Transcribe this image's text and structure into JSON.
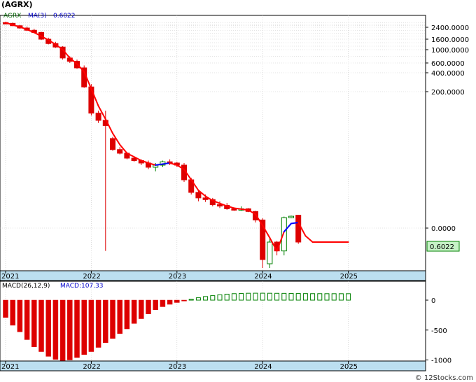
{
  "title": "(AGRX)",
  "footer": "© 12Stocks.com",
  "colors": {
    "up": "#008000",
    "down": "#dd0000",
    "ma_down": "#ff0000",
    "ma_up": "#0000ff",
    "axis_band": "#bcdff0",
    "value_box_bg": "#c6f2c6",
    "value_box_border": "#008000"
  },
  "price_panel": {
    "legend": {
      "ticker": "AGRX",
      "ma_label": "MA(3)",
      "ma_value": "0.6022"
    },
    "last_value": "0.6022",
    "y_tick_labels": [
      {
        "label": "2400.0000",
        "value": 2400
      },
      {
        "label": "1600.0000",
        "value": 1600
      },
      {
        "label": "1000.0000",
        "value": 1000
      },
      {
        "label": "600.0000",
        "value": 600
      },
      {
        "label": "400.0000",
        "value": 400
      },
      {
        "label": "200.0000",
        "value": 200
      },
      {
        "label": "0.0000",
        "value": 0
      }
    ]
  },
  "macd_panel": {
    "legend": {
      "params": "MACD(26,12,9)",
      "value_label": "MACD:107.33"
    },
    "y_tick_labels": [
      {
        "label": "0",
        "value": 0
      },
      {
        "label": "-500",
        "value": -500
      },
      {
        "label": "-1000",
        "value": -1000
      }
    ]
  },
  "x_axis_labels": [
    "2021",
    "2022",
    "2023",
    "2024",
    "2025"
  ],
  "chart_data": {
    "type": "candlestick",
    "title": "(AGRX)",
    "x_axis": {
      "labels": [
        "2021",
        "2022",
        "2023",
        "2024",
        "2025"
      ],
      "months": [
        0,
        12,
        24,
        36,
        48
      ]
    },
    "price_scale": "non-linear (compressed at top)",
    "candles": [
      {
        "m": 0,
        "open": 3000,
        "high": 3100,
        "low": 2800,
        "close": 2900,
        "dir": "down"
      },
      {
        "m": 1,
        "open": 2900,
        "high": 3000,
        "low": 2550,
        "close": 2600,
        "dir": "down"
      },
      {
        "m": 2,
        "open": 2600,
        "high": 2700,
        "low": 2300,
        "close": 2350,
        "dir": "down"
      },
      {
        "m": 3,
        "open": 2350,
        "high": 2500,
        "low": 2150,
        "close": 2200,
        "dir": "down"
      },
      {
        "m": 4,
        "open": 2200,
        "high": 2300,
        "low": 2000,
        "close": 2050,
        "dir": "down"
      },
      {
        "m": 5,
        "open": 2050,
        "high": 2100,
        "low": 1550,
        "close": 1600,
        "dir": "down"
      },
      {
        "m": 6,
        "open": 1600,
        "high": 1700,
        "low": 1300,
        "close": 1350,
        "dir": "down"
      },
      {
        "m": 7,
        "open": 1350,
        "high": 1450,
        "low": 1100,
        "close": 1150,
        "dir": "down"
      },
      {
        "m": 8,
        "open": 1150,
        "high": 1200,
        "low": 700,
        "close": 750,
        "dir": "down"
      },
      {
        "m": 9,
        "open": 750,
        "high": 800,
        "low": 600,
        "close": 650,
        "dir": "down"
      },
      {
        "m": 10,
        "open": 650,
        "high": 700,
        "low": 480,
        "close": 500,
        "dir": "down"
      },
      {
        "m": 11,
        "open": 500,
        "high": 550,
        "low": 240,
        "close": 250,
        "dir": "down"
      },
      {
        "m": 12,
        "open": 250,
        "high": 280,
        "low": 100,
        "close": 110,
        "dir": "down"
      },
      {
        "m": 13,
        "open": 110,
        "high": 120,
        "low": 75,
        "close": 80,
        "dir": "down"
      },
      {
        "m": 14,
        "open": 80,
        "high": 120,
        "low": 0.5,
        "close": 70,
        "dir": "down"
      },
      {
        "m": 15,
        "open": 45,
        "high": 48,
        "low": 35,
        "close": 36,
        "dir": "down"
      },
      {
        "m": 16,
        "open": 36,
        "high": 38,
        "low": 32,
        "close": 33,
        "dir": "down"
      },
      {
        "m": 17,
        "open": 33,
        "high": 34,
        "low": 28,
        "close": 29,
        "dir": "down"
      },
      {
        "m": 18,
        "open": 29,
        "high": 30,
        "low": 26,
        "close": 27,
        "dir": "down"
      },
      {
        "m": 19,
        "open": 27,
        "high": 28,
        "low": 24,
        "close": 25,
        "dir": "down"
      },
      {
        "m": 20,
        "open": 25,
        "high": 27,
        "low": 22,
        "close": 23,
        "dir": "down"
      },
      {
        "m": 21,
        "open": 23,
        "high": 25,
        "low": 21,
        "close": 24,
        "dir": "up"
      },
      {
        "m": 22,
        "open": 24,
        "high": 27,
        "low": 23,
        "close": 26,
        "dir": "up"
      },
      {
        "m": 23,
        "open": 26,
        "high": 28,
        "low": 24,
        "close": 25,
        "dir": "down"
      },
      {
        "m": 24,
        "open": 25,
        "high": 26,
        "low": 23,
        "close": 24,
        "dir": "down"
      },
      {
        "m": 25,
        "open": 24,
        "high": 25,
        "low": 16,
        "close": 17,
        "dir": "down"
      },
      {
        "m": 26,
        "open": 17,
        "high": 18,
        "low": 10,
        "close": 11,
        "dir": "down"
      },
      {
        "m": 27,
        "open": 11,
        "high": 12,
        "low": 8,
        "close": 9,
        "dir": "down"
      },
      {
        "m": 28,
        "open": 9,
        "high": 10,
        "low": 7.8,
        "close": 8.5,
        "dir": "down"
      },
      {
        "m": 29,
        "open": 8.5,
        "high": 9,
        "low": 6.5,
        "close": 7,
        "dir": "down"
      },
      {
        "m": 30,
        "open": 7,
        "high": 8,
        "low": 6,
        "close": 6.8,
        "dir": "down"
      },
      {
        "m": 31,
        "open": 6.8,
        "high": 7.5,
        "low": 5.5,
        "close": 5.8,
        "dir": "down"
      },
      {
        "m": 32,
        "open": 5.8,
        "high": 6.2,
        "low": 5.2,
        "close": 5.6,
        "dir": "down"
      },
      {
        "m": 33,
        "open": 5.6,
        "high": 6.5,
        "low": 5.2,
        "close": 5.8,
        "dir": "up"
      },
      {
        "m": 34,
        "open": 5.8,
        "high": 6.0,
        "low": 4.8,
        "close": 5.0,
        "dir": "down"
      },
      {
        "m": 35,
        "open": 5.0,
        "high": 5.2,
        "low": 2.5,
        "close": 2.8,
        "dir": "down"
      },
      {
        "m": 36,
        "open": 2.8,
        "high": 3.0,
        "low": 0.3,
        "close": 0.4,
        "dir": "down"
      },
      {
        "m": 37,
        "open": 0.35,
        "high": 0.9,
        "low": 0.3,
        "close": 0.6,
        "dir": "up"
      },
      {
        "m": 38,
        "open": 0.6,
        "high": 0.7,
        "low": 0.45,
        "close": 0.5,
        "dir": "down"
      },
      {
        "m": 39,
        "open": 0.5,
        "high": 3.5,
        "low": 0.45,
        "close": 3.2,
        "dir": "up"
      },
      {
        "m": 40,
        "open": 3.2,
        "high": 3.8,
        "low": 3.0,
        "close": 3.6,
        "dir": "up"
      },
      {
        "m": 41,
        "open": 3.9,
        "high": 4.0,
        "low": 0.58,
        "close": 0.6022,
        "dir": "down"
      }
    ],
    "ma3": {
      "label": "MA(3)",
      "values": [
        [
          0,
          3000
        ],
        [
          1,
          2700
        ],
        [
          2,
          2450
        ],
        [
          3,
          2250
        ],
        [
          4,
          2050
        ],
        [
          5,
          1800
        ],
        [
          6,
          1550
        ],
        [
          7,
          1300
        ],
        [
          8,
          1000
        ],
        [
          9,
          750
        ],
        [
          10,
          580
        ],
        [
          11,
          420
        ],
        [
          12,
          230
        ],
        [
          13,
          140
        ],
        [
          14,
          85
        ],
        [
          15,
          55
        ],
        [
          16,
          40
        ],
        [
          17,
          33
        ],
        [
          18,
          30
        ],
        [
          19,
          27
        ],
        [
          20,
          25
        ],
        [
          21,
          24
        ],
        [
          22,
          24.5
        ],
        [
          23,
          25
        ],
        [
          24,
          24
        ],
        [
          25,
          22
        ],
        [
          26,
          17
        ],
        [
          27,
          12
        ],
        [
          28,
          9.5
        ],
        [
          29,
          8.2
        ],
        [
          30,
          7.4
        ],
        [
          31,
          6.6
        ],
        [
          32,
          6.0
        ],
        [
          33,
          5.7
        ],
        [
          34,
          5.4
        ],
        [
          35,
          4.2
        ],
        [
          36,
          2.2
        ],
        [
          37,
          1.0
        ],
        [
          38,
          0.5
        ],
        [
          39,
          1.6
        ],
        [
          40,
          2.4
        ],
        [
          41,
          2.5
        ],
        [
          42,
          1.2
        ],
        [
          43,
          0.6022
        ],
        [
          44,
          0.6022
        ],
        [
          45,
          0.6022
        ],
        [
          46,
          0.6022
        ],
        [
          47,
          0.6022
        ],
        [
          48,
          0.6022
        ]
      ],
      "up_segment_months": [
        21,
        22,
        23,
        39,
        40,
        41
      ]
    },
    "macd": {
      "label": "MACD(26,12,9)",
      "last_value": 107.33,
      "ylim": [
        -1050,
        120
      ],
      "values": [
        [
          0,
          -290
        ],
        [
          1,
          -420
        ],
        [
          2,
          -530
        ],
        [
          3,
          -660
        ],
        [
          4,
          -780
        ],
        [
          5,
          -860
        ],
        [
          6,
          -940
        ],
        [
          7,
          -990
        ],
        [
          8,
          -1010
        ],
        [
          9,
          -1000
        ],
        [
          10,
          -960
        ],
        [
          11,
          -910
        ],
        [
          12,
          -860
        ],
        [
          13,
          -790
        ],
        [
          14,
          -710
        ],
        [
          15,
          -640
        ],
        [
          16,
          -560
        ],
        [
          17,
          -480
        ],
        [
          18,
          -390
        ],
        [
          19,
          -310
        ],
        [
          20,
          -230
        ],
        [
          21,
          -160
        ],
        [
          22,
          -110
        ],
        [
          23,
          -70
        ],
        [
          24,
          -40
        ],
        [
          25,
          -15
        ],
        [
          26,
          15
        ],
        [
          27,
          40
        ],
        [
          28,
          60
        ],
        [
          29,
          75
        ],
        [
          30,
          90
        ],
        [
          31,
          100
        ],
        [
          32,
          108
        ],
        [
          33,
          112
        ],
        [
          34,
          115
        ],
        [
          35,
          116
        ],
        [
          36,
          116
        ],
        [
          37,
          115
        ],
        [
          38,
          114
        ],
        [
          39,
          113
        ],
        [
          40,
          112
        ],
        [
          41,
          110
        ],
        [
          42,
          109
        ],
        [
          43,
          108
        ],
        [
          44,
          108
        ],
        [
          45,
          107.5
        ],
        [
          46,
          107.4
        ],
        [
          47,
          107.33
        ],
        [
          48,
          107.33
        ]
      ]
    }
  }
}
